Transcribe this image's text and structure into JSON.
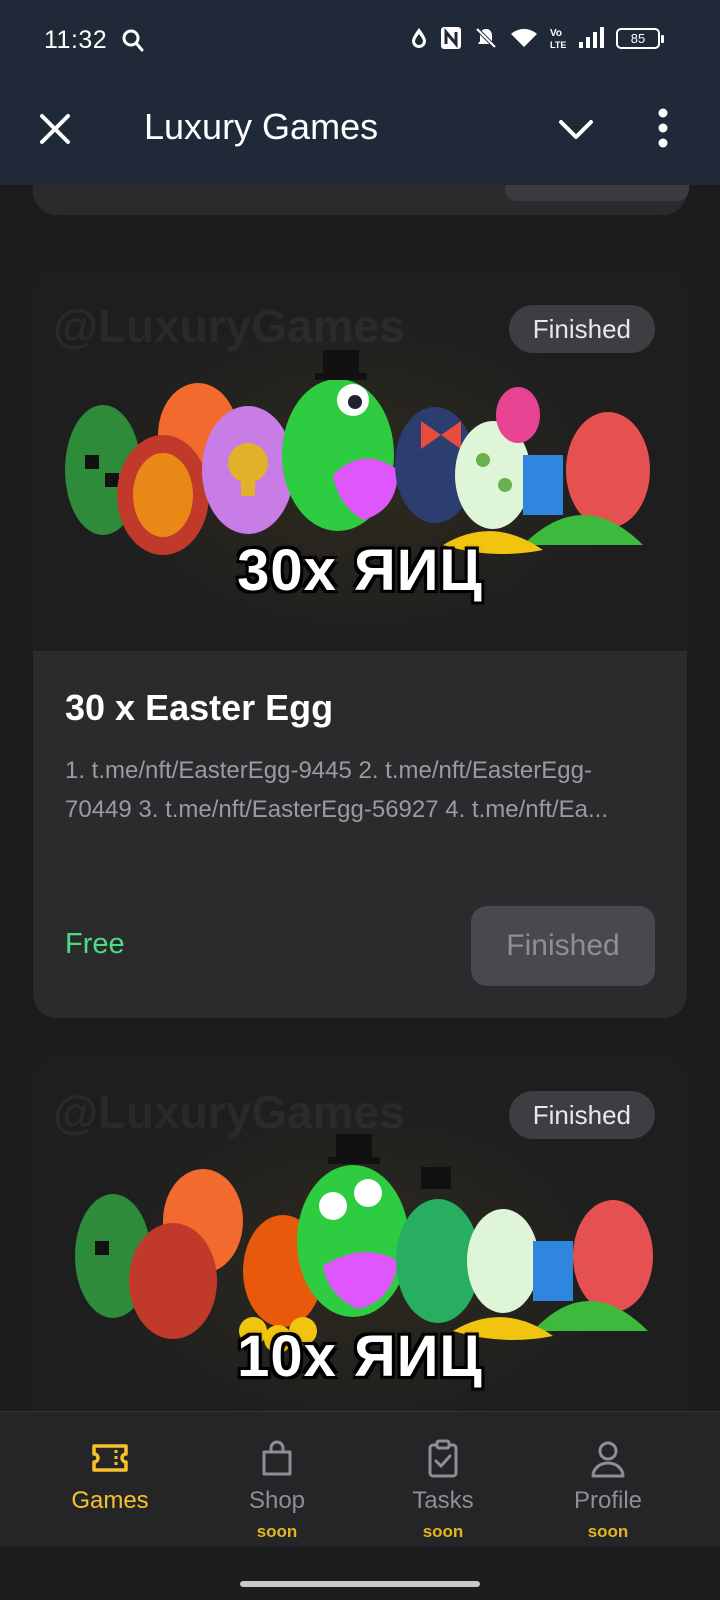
{
  "status_bar": {
    "time": "11:32",
    "battery": "85",
    "icons": [
      "search-icon",
      "data-saver-icon",
      "nfc-icon",
      "mute-icon",
      "wifi-icon",
      "volte-icon",
      "signal-icon",
      "battery-icon"
    ]
  },
  "header": {
    "title": "Luxury Games",
    "icons": [
      "close-icon",
      "chevron-down-icon",
      "more-vertical-icon"
    ]
  },
  "cards": [
    {
      "badge": "Finished",
      "banner_text": "30x ЯИЦ",
      "watermark": "@LuxuryGames",
      "title": "30 x Easter Egg",
      "description": "1. t.me/nft/EasterEgg-9445 2. t.me/nft/EasterEgg-70449 3. t.me/nft/EasterEgg-56927 4. t.me/nft/Ea...",
      "price": "Free",
      "button": "Finished"
    },
    {
      "badge": "Finished",
      "banner_text": "10x ЯИЦ",
      "watermark": "@LuxuryGames"
    }
  ],
  "bottom_nav": [
    {
      "label": "Games",
      "sub": "",
      "icon": "ticket-icon",
      "active": true
    },
    {
      "label": "Shop",
      "sub": "soon",
      "icon": "shopping-bag-icon",
      "active": false
    },
    {
      "label": "Tasks",
      "sub": "soon",
      "icon": "clipboard-check-icon",
      "active": false
    },
    {
      "label": "Profile",
      "sub": "soon",
      "icon": "user-icon",
      "active": false
    }
  ],
  "colors": {
    "accent": "#f5c22b",
    "price_green": "#4ade80",
    "header_bg": "#1f2937",
    "card_bg": "#2b2b2e"
  }
}
